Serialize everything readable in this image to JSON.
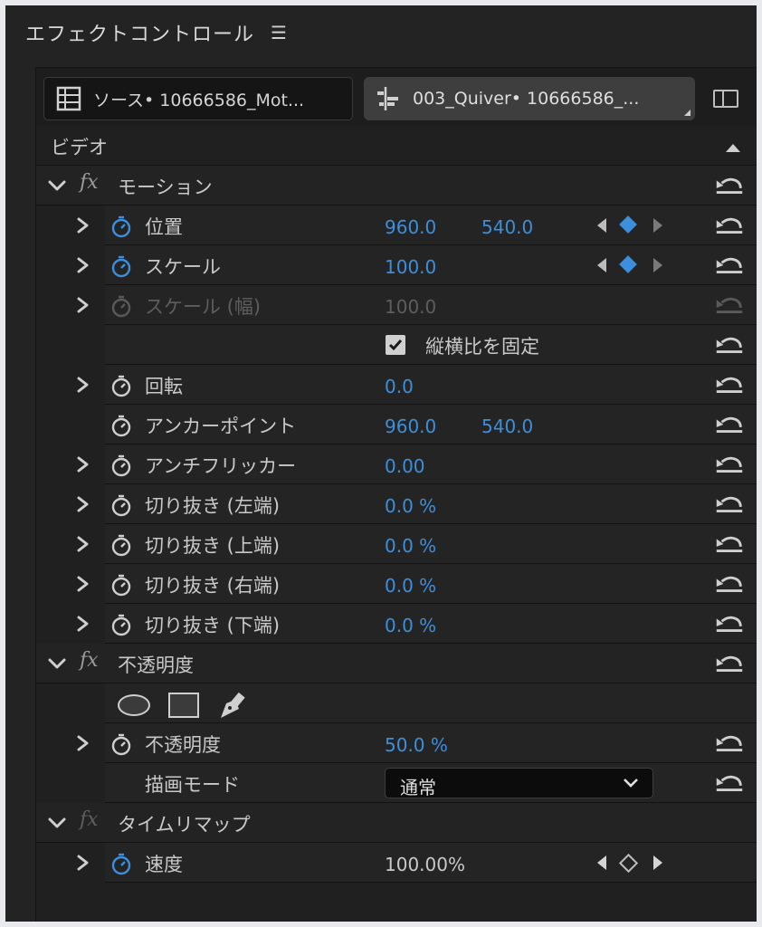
{
  "panel": {
    "title": "エフェクトコントロール"
  },
  "clips": {
    "source_label": "ソース• 10666586_Mot...",
    "sequence_label": "003_Quiver• 10666586_..."
  },
  "video_header": "ビデオ",
  "motion": {
    "title": "モーション",
    "position": {
      "label": "位置",
      "x": "960.0",
      "y": "540.0"
    },
    "scale": {
      "label": "スケール",
      "value": "100.0"
    },
    "scale_width": {
      "label": "スケール (幅)",
      "value": "100.0"
    },
    "uniform_scale": {
      "label": "縦横比を固定",
      "checked": true
    },
    "rotation": {
      "label": "回転",
      "value": "0.0"
    },
    "anchor": {
      "label": "アンカーポイント",
      "x": "960.0",
      "y": "540.0"
    },
    "antiflicker": {
      "label": "アンチフリッカー",
      "value": "0.00"
    },
    "crop_left": {
      "label": "切り抜き (左端)",
      "value": "0.0 %"
    },
    "crop_top": {
      "label": "切り抜き (上端)",
      "value": "0.0 %"
    },
    "crop_right": {
      "label": "切り抜き (右端)",
      "value": "0.0 %"
    },
    "crop_bottom": {
      "label": "切り抜き (下端)",
      "value": "0.0 %"
    }
  },
  "opacity": {
    "title": "不透明度",
    "value_label": "不透明度",
    "value": "50.0 %",
    "blend_label": "描画モード",
    "blend_value": "通常"
  },
  "time_remap": {
    "title": "タイムリマップ",
    "speed_label": "速度",
    "speed_value": "100.00%"
  },
  "colors": {
    "value_blue": "#3c8fdc",
    "panel_bg": "#232323"
  },
  "icons": [
    "menu-icon",
    "source-clip-icon",
    "sequence-clip-icon",
    "panel-toggle-icon",
    "fx-icon",
    "stopwatch-icon",
    "reset-icon",
    "keyframe-nav-icon",
    "checkmark-icon",
    "ellipse-mask-icon",
    "rectangle-mask-icon",
    "pen-mask-icon",
    "chevron-down-icon"
  ]
}
